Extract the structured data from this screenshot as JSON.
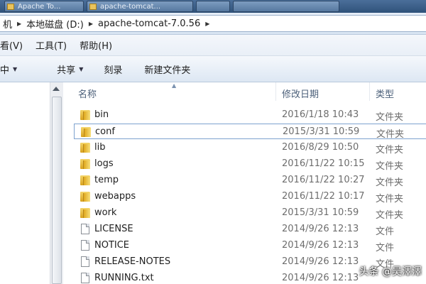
{
  "taskbar": {
    "buttons": [
      {
        "label": "Apache To..."
      },
      {
        "label": "apache-tomcat..."
      },
      {
        "label": ""
      },
      {
        "label": ""
      }
    ]
  },
  "address": {
    "crumbs": [
      "机",
      "本地磁盘 (D:)",
      "apache-tomcat-7.0.56"
    ]
  },
  "menu": {
    "items": [
      "看(V)",
      "工具(T)",
      "帮助(H)"
    ]
  },
  "commands": {
    "items": [
      "中",
      "共享",
      "刻录",
      "新建文件夹"
    ]
  },
  "columns": {
    "name": "名称",
    "date": "修改日期",
    "type": "类型"
  },
  "files": [
    {
      "name": "bin",
      "date": "2016/1/18 10:43",
      "type": "文件夹",
      "kind": "folder"
    },
    {
      "name": "conf",
      "date": "2015/3/31 10:59",
      "type": "文件夹",
      "kind": "folder"
    },
    {
      "name": "lib",
      "date": "2016/8/29 10:50",
      "type": "文件夹",
      "kind": "folder"
    },
    {
      "name": "logs",
      "date": "2016/11/22 10:15",
      "type": "文件夹",
      "kind": "folder"
    },
    {
      "name": "temp",
      "date": "2016/11/22 10:27",
      "type": "文件夹",
      "kind": "folder"
    },
    {
      "name": "webapps",
      "date": "2016/11/22 10:17",
      "type": "文件夹",
      "kind": "folder"
    },
    {
      "name": "work",
      "date": "2015/3/31 10:59",
      "type": "文件夹",
      "kind": "folder"
    },
    {
      "name": "LICENSE",
      "date": "2014/9/26 12:13",
      "type": "文件",
      "kind": "file"
    },
    {
      "name": "NOTICE",
      "date": "2014/9/26 12:13",
      "type": "文件",
      "kind": "file"
    },
    {
      "name": "RELEASE-NOTES",
      "date": "2014/9/26 12:13",
      "type": "文件",
      "kind": "file"
    },
    {
      "name": "RUNNING.txt",
      "date": "2014/9/26 12:13",
      "type": "",
      "kind": "file"
    }
  ],
  "watermark": "头条 @吴澤澤",
  "icons": {
    "folder": "folder-icon",
    "file": "file-icon",
    "dropdown": "chevron-down-icon",
    "breadcrumb_separator": "chevron-right-icon"
  }
}
